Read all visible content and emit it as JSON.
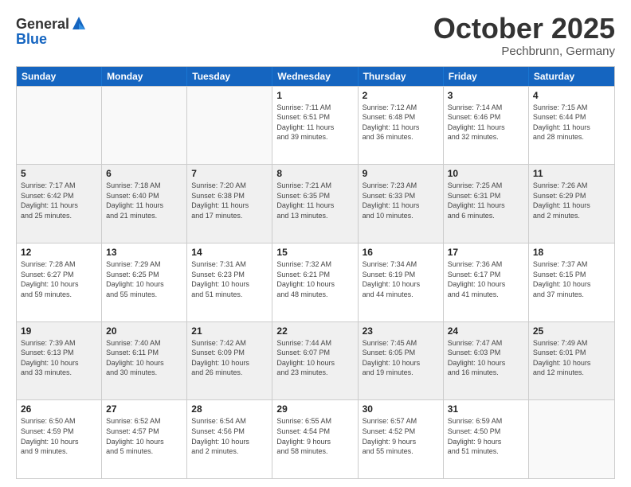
{
  "header": {
    "logo_general": "General",
    "logo_blue": "Blue",
    "month": "October 2025",
    "location": "Pechbrunn, Germany"
  },
  "days_of_week": [
    "Sunday",
    "Monday",
    "Tuesday",
    "Wednesday",
    "Thursday",
    "Friday",
    "Saturday"
  ],
  "rows": [
    [
      {
        "day": "",
        "info": "",
        "empty": true
      },
      {
        "day": "",
        "info": "",
        "empty": true
      },
      {
        "day": "",
        "info": "",
        "empty": true
      },
      {
        "day": "1",
        "info": "Sunrise: 7:11 AM\nSunset: 6:51 PM\nDaylight: 11 hours\nand 39 minutes."
      },
      {
        "day": "2",
        "info": "Sunrise: 7:12 AM\nSunset: 6:48 PM\nDaylight: 11 hours\nand 36 minutes."
      },
      {
        "day": "3",
        "info": "Sunrise: 7:14 AM\nSunset: 6:46 PM\nDaylight: 11 hours\nand 32 minutes."
      },
      {
        "day": "4",
        "info": "Sunrise: 7:15 AM\nSunset: 6:44 PM\nDaylight: 11 hours\nand 28 minutes."
      }
    ],
    [
      {
        "day": "5",
        "info": "Sunrise: 7:17 AM\nSunset: 6:42 PM\nDaylight: 11 hours\nand 25 minutes."
      },
      {
        "day": "6",
        "info": "Sunrise: 7:18 AM\nSunset: 6:40 PM\nDaylight: 11 hours\nand 21 minutes."
      },
      {
        "day": "7",
        "info": "Sunrise: 7:20 AM\nSunset: 6:38 PM\nDaylight: 11 hours\nand 17 minutes."
      },
      {
        "day": "8",
        "info": "Sunrise: 7:21 AM\nSunset: 6:35 PM\nDaylight: 11 hours\nand 13 minutes."
      },
      {
        "day": "9",
        "info": "Sunrise: 7:23 AM\nSunset: 6:33 PM\nDaylight: 11 hours\nand 10 minutes."
      },
      {
        "day": "10",
        "info": "Sunrise: 7:25 AM\nSunset: 6:31 PM\nDaylight: 11 hours\nand 6 minutes."
      },
      {
        "day": "11",
        "info": "Sunrise: 7:26 AM\nSunset: 6:29 PM\nDaylight: 11 hours\nand 2 minutes."
      }
    ],
    [
      {
        "day": "12",
        "info": "Sunrise: 7:28 AM\nSunset: 6:27 PM\nDaylight: 10 hours\nand 59 minutes."
      },
      {
        "day": "13",
        "info": "Sunrise: 7:29 AM\nSunset: 6:25 PM\nDaylight: 10 hours\nand 55 minutes."
      },
      {
        "day": "14",
        "info": "Sunrise: 7:31 AM\nSunset: 6:23 PM\nDaylight: 10 hours\nand 51 minutes."
      },
      {
        "day": "15",
        "info": "Sunrise: 7:32 AM\nSunset: 6:21 PM\nDaylight: 10 hours\nand 48 minutes."
      },
      {
        "day": "16",
        "info": "Sunrise: 7:34 AM\nSunset: 6:19 PM\nDaylight: 10 hours\nand 44 minutes."
      },
      {
        "day": "17",
        "info": "Sunrise: 7:36 AM\nSunset: 6:17 PM\nDaylight: 10 hours\nand 41 minutes."
      },
      {
        "day": "18",
        "info": "Sunrise: 7:37 AM\nSunset: 6:15 PM\nDaylight: 10 hours\nand 37 minutes."
      }
    ],
    [
      {
        "day": "19",
        "info": "Sunrise: 7:39 AM\nSunset: 6:13 PM\nDaylight: 10 hours\nand 33 minutes."
      },
      {
        "day": "20",
        "info": "Sunrise: 7:40 AM\nSunset: 6:11 PM\nDaylight: 10 hours\nand 30 minutes."
      },
      {
        "day": "21",
        "info": "Sunrise: 7:42 AM\nSunset: 6:09 PM\nDaylight: 10 hours\nand 26 minutes."
      },
      {
        "day": "22",
        "info": "Sunrise: 7:44 AM\nSunset: 6:07 PM\nDaylight: 10 hours\nand 23 minutes."
      },
      {
        "day": "23",
        "info": "Sunrise: 7:45 AM\nSunset: 6:05 PM\nDaylight: 10 hours\nand 19 minutes."
      },
      {
        "day": "24",
        "info": "Sunrise: 7:47 AM\nSunset: 6:03 PM\nDaylight: 10 hours\nand 16 minutes."
      },
      {
        "day": "25",
        "info": "Sunrise: 7:49 AM\nSunset: 6:01 PM\nDaylight: 10 hours\nand 12 minutes."
      }
    ],
    [
      {
        "day": "26",
        "info": "Sunrise: 6:50 AM\nSunset: 4:59 PM\nDaylight: 10 hours\nand 9 minutes."
      },
      {
        "day": "27",
        "info": "Sunrise: 6:52 AM\nSunset: 4:57 PM\nDaylight: 10 hours\nand 5 minutes."
      },
      {
        "day": "28",
        "info": "Sunrise: 6:54 AM\nSunset: 4:56 PM\nDaylight: 10 hours\nand 2 minutes."
      },
      {
        "day": "29",
        "info": "Sunrise: 6:55 AM\nSunset: 4:54 PM\nDaylight: 9 hours\nand 58 minutes."
      },
      {
        "day": "30",
        "info": "Sunrise: 6:57 AM\nSunset: 4:52 PM\nDaylight: 9 hours\nand 55 minutes."
      },
      {
        "day": "31",
        "info": "Sunrise: 6:59 AM\nSunset: 4:50 PM\nDaylight: 9 hours\nand 51 minutes."
      },
      {
        "day": "",
        "info": "",
        "empty": true
      }
    ]
  ]
}
